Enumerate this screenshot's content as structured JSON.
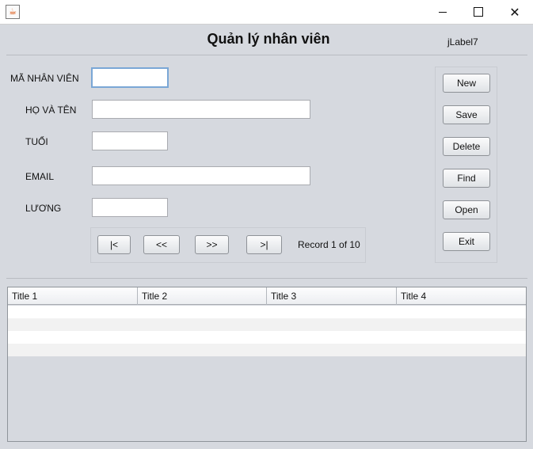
{
  "window": {
    "app_icon": "java-coffee-icon",
    "controls": [
      "minimize-icon",
      "maximize-icon",
      "close-icon"
    ]
  },
  "header": {
    "title": "Quản lý nhân viên",
    "side_label": "jLabel7"
  },
  "form": {
    "id_label": "MÃ NHÂN VIÊN",
    "id_value": "",
    "name_label": "HỌ VÀ TÊN",
    "name_value": "",
    "age_label": "TUỔI",
    "age_value": "",
    "email_label": "EMAIL",
    "email_value": "",
    "salary_label": "LƯƠNG",
    "salary_value": ""
  },
  "navigation": {
    "first": "|<",
    "prev": "<<",
    "next": ">>",
    "last": ">|",
    "record_text": "Record 1 of 10"
  },
  "actions": {
    "new": "New",
    "save": "Save",
    "delete": "Delete",
    "find": "Find",
    "open": "Open",
    "exit": "Exit"
  },
  "table": {
    "columns": [
      "Title 1",
      "Title 2",
      "Title 3",
      "Title 4"
    ],
    "rows": [
      [
        "",
        "",
        "",
        ""
      ],
      [
        "",
        "",
        "",
        ""
      ],
      [
        "",
        "",
        "",
        ""
      ],
      [
        "",
        "",
        "",
        ""
      ]
    ]
  },
  "colors": {
    "background": "#d6d9df",
    "focus_border": "#7aa7d6",
    "row_alt": "#f2f2f2"
  }
}
